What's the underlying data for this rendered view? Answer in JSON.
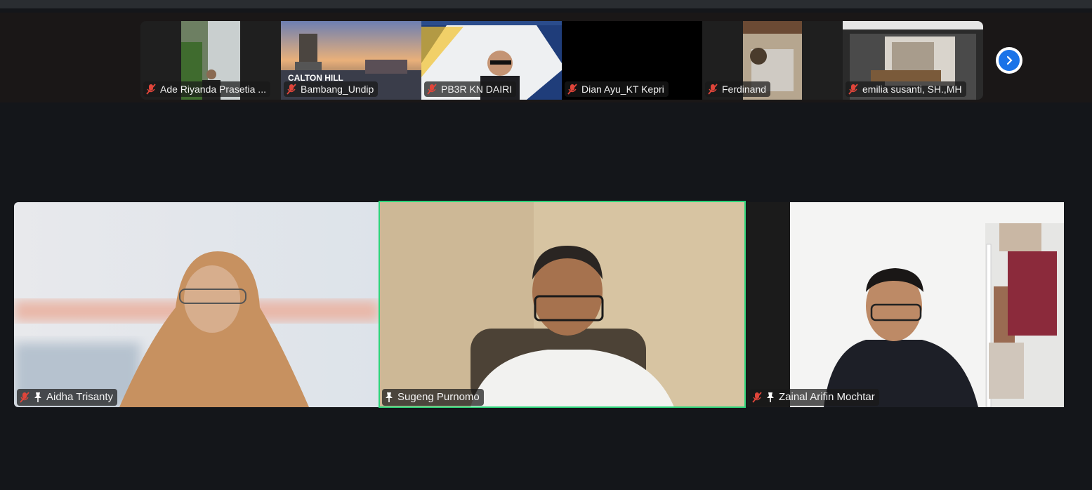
{
  "thumbnails": [
    {
      "name": "Ade Riyanda Prasetia ...",
      "muted": true
    },
    {
      "name": "Bambang_Undip",
      "muted": true,
      "overlay_text": "CALTON HILL"
    },
    {
      "name": "PB3R KN DAIRI",
      "muted": true
    },
    {
      "name": "Dian Ayu_KT Kepri",
      "muted": true
    },
    {
      "name": "Ferdinand",
      "muted": true
    },
    {
      "name": "emilia susanti, SH.,MH",
      "muted": true
    }
  ],
  "next_button": {
    "icon": "chevron-right-icon"
  },
  "main_tiles": [
    {
      "name": "Aidha Trisanty",
      "muted": true,
      "pinned": true
    },
    {
      "name": "Sugeng Purnomo",
      "muted": false,
      "pinned": true,
      "active_speaker": true
    },
    {
      "name": "Zainal Arifin Mochtar",
      "muted": true,
      "pinned": true
    }
  ],
  "colors": {
    "background": "#14161a",
    "active_speaker": "#2ed47a",
    "muted_icon": "#e0453a",
    "next_button": "#1a73e8"
  }
}
